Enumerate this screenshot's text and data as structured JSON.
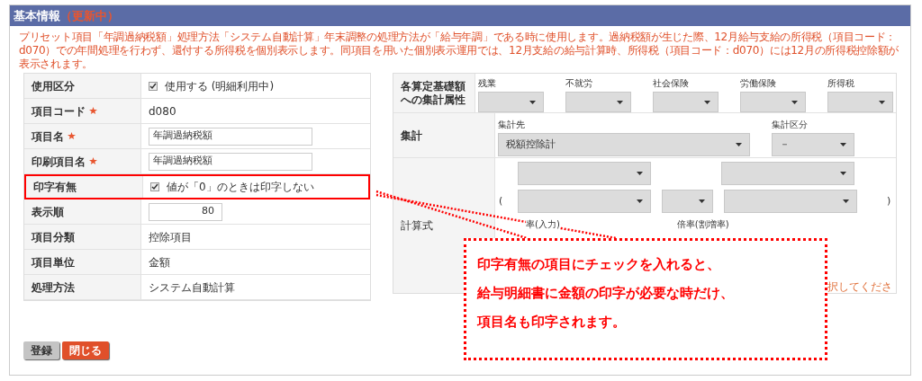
{
  "header": {
    "title": "基本情報",
    "status": "（更新中）"
  },
  "notice": "プリセット項目「年調過納税額」処理方法「システム自動計算」年末調整の処理方法が「給与年調」である時に使用します。過納税額が生じた際、12月給与支給の所得税（項目コード：d070）での年間処理を行わず、還付する所得税を個別表示します。同項目を用いた個別表示運用では、12月支給の給与計算時、所得税（項目コード：d070）には12月の所得税控除額が表示されます。",
  "item_table": [
    {
      "label": "使用区分",
      "required": false,
      "kind": "checkbox",
      "checked": true,
      "value": "使用する (明細利用中)",
      "highlighted": false
    },
    {
      "label": "項目コード",
      "required": true,
      "kind": "text",
      "value": "d080",
      "highlighted": false
    },
    {
      "label": "項目名",
      "required": true,
      "kind": "input",
      "value": "年調過納税額",
      "highlighted": false
    },
    {
      "label": "印刷項目名",
      "required": true,
      "kind": "input",
      "value": "年調過納税額",
      "highlighted": false
    },
    {
      "label": "印字有無",
      "required": false,
      "kind": "checkbox",
      "checked": true,
      "value": "値が「0」のときは印字しない",
      "highlighted": true
    },
    {
      "label": "表示順",
      "required": false,
      "kind": "number",
      "value": "80",
      "highlighted": false
    },
    {
      "label": "項目分類",
      "required": false,
      "kind": "text",
      "value": "控除項目",
      "highlighted": false
    },
    {
      "label": "項目単位",
      "required": false,
      "kind": "text",
      "value": "金額",
      "highlighted": false
    },
    {
      "label": "処理方法",
      "required": false,
      "kind": "text",
      "value": "システム自動計算",
      "highlighted": false
    }
  ],
  "attributes": {
    "label": "各算定基礎額への集計属性",
    "selects": [
      {
        "label": "残業"
      },
      {
        "label": "不就労"
      },
      {
        "label": "社会保険"
      },
      {
        "label": "労働保険"
      },
      {
        "label": "所得税"
      }
    ]
  },
  "aggregation": {
    "label": "集計",
    "target": {
      "label": "集計先",
      "value": "税額控除計"
    },
    "category": {
      "label": "集計区分",
      "value": "－"
    }
  },
  "formula": {
    "label": "計算式",
    "open_paren": "(",
    "close_paren": ")",
    "rate_label": "率(入力)",
    "multiplier_label": "倍率(割増率)",
    "hint": "択してくださ"
  },
  "buttons": [
    {
      "label": "登録",
      "kind": "secondary"
    },
    {
      "label": "閉じる",
      "kind": "primary"
    }
  ],
  "callout": {
    "lines": [
      "印字有無の項目にチェックを入れると、",
      "給与明細書に金額の印字が必要な時だけ、",
      "項目名も印字されます。"
    ]
  }
}
